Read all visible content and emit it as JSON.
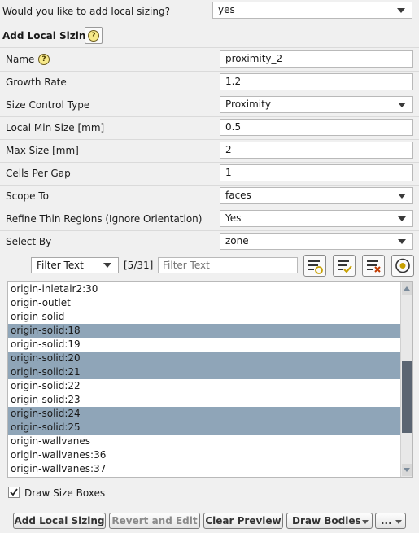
{
  "add_local_sizing_question": {
    "label": "Would you like to add local sizing?",
    "value": "yes"
  },
  "section_title": "Add Local Sizing",
  "help_glyph": "?",
  "form": {
    "name": {
      "label": "Name",
      "value": "proximity_2"
    },
    "growth_rate": {
      "label": "Growth Rate",
      "value": "1.2"
    },
    "size_control_type": {
      "label": "Size Control Type",
      "value": "Proximity"
    },
    "local_min_size": {
      "label": "Local Min Size [mm]",
      "value": "0.5"
    },
    "max_size": {
      "label": "Max Size [mm]",
      "value": "2"
    },
    "cells_per_gap": {
      "label": "Cells Per Gap",
      "value": "1"
    },
    "scope_to": {
      "label": "Scope To",
      "value": "faces"
    },
    "refine_thin_regions": {
      "label": "Refine Thin Regions (Ignore Orientation)",
      "value": "Yes"
    },
    "select_by": {
      "label": "Select By",
      "value": "zone"
    }
  },
  "filter": {
    "mode": "Filter Text",
    "count": "[5/31]",
    "placeholder": "Filter Text"
  },
  "zones": [
    {
      "name": "origin-inletair2:30",
      "selected": false
    },
    {
      "name": "origin-outlet",
      "selected": false
    },
    {
      "name": "origin-solid",
      "selected": false
    },
    {
      "name": "origin-solid:18",
      "selected": true
    },
    {
      "name": "origin-solid:19",
      "selected": false
    },
    {
      "name": "origin-solid:20",
      "selected": true
    },
    {
      "name": "origin-solid:21",
      "selected": true
    },
    {
      "name": "origin-solid:22",
      "selected": false
    },
    {
      "name": "origin-solid:23",
      "selected": false
    },
    {
      "name": "origin-solid:24",
      "selected": true
    },
    {
      "name": "origin-solid:25",
      "selected": true
    },
    {
      "name": "origin-wallvanes",
      "selected": false
    },
    {
      "name": "origin-wallvanes:36",
      "selected": false
    },
    {
      "name": "origin-wallvanes:37",
      "selected": false
    }
  ],
  "draw_size_boxes": {
    "label": "Draw Size Boxes",
    "checked": true
  },
  "buttons": {
    "add_local_sizing": "Add Local Sizing",
    "revert_and_edit": "Revert and Edit",
    "clear_preview": "Clear Preview",
    "draw_bodies": "Draw Bodies",
    "more": "..."
  },
  "colors": {
    "selection": "#8fa5b8",
    "help_icon": "#f7e98a"
  }
}
